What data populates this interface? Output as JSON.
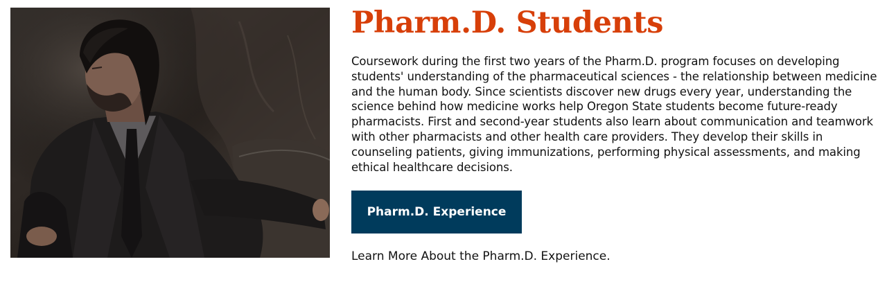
{
  "section": {
    "title": "Pharm.D. Students",
    "description": "Coursework during the first two years of the Pharm.D. program focuses on developing students' understanding of the pharmaceutical sciences - the relationship between medicine and the human body. Since scientists discover new drugs every year, understanding the science behind how medicine works help Oregon State students become future-ready pharmacists. First and second-year students also learn about communication and teamwork with other pharmacists and other health care providers. They develop their skills in counseling patients, giving immunizations, performing physical assessments, and making ethical healthcare decisions.",
    "button_label": "Pharm.D. Experience",
    "link_text": "Learn More About the Pharm.D. Experience."
  },
  "colors": {
    "title": "#D73F09",
    "button_bg": "#003B5C",
    "button_text": "#FFFFFF",
    "text": "#111111"
  }
}
